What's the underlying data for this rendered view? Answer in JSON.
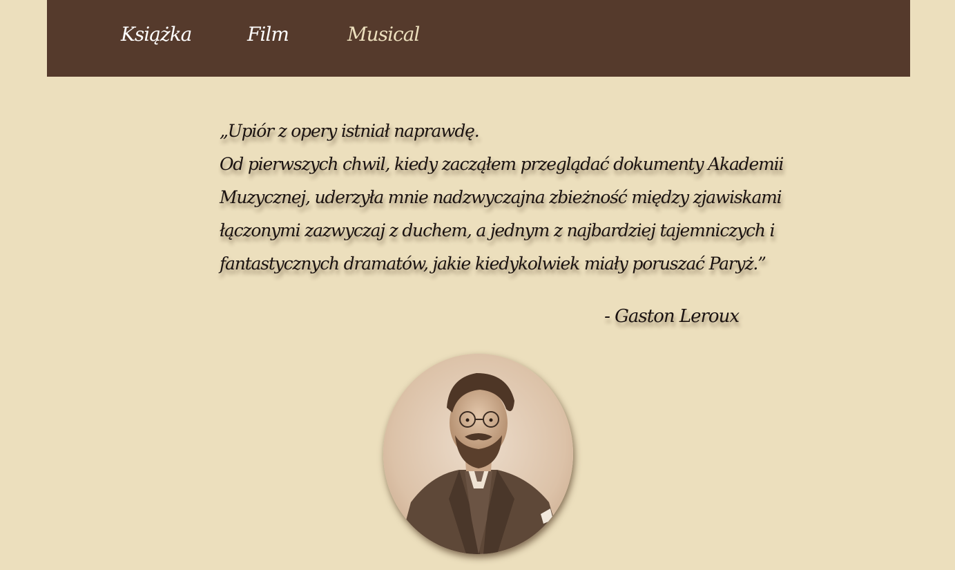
{
  "nav": {
    "items": [
      {
        "label": "Książka"
      },
      {
        "label": "Film"
      },
      {
        "label": "Musical"
      }
    ],
    "active_color": "#ecdfbd"
  },
  "quote": {
    "lines": [
      "„Upiór z opery istniał naprawdę.",
      "Od pierwszych chwil, kiedy zacząłem przeglądać dokumenty Akademii",
      "Muzycznej, uderzyła mnie nadzwyczajna zbieżność między zjawiskami",
      "łączonymi zazwyczaj z duchem, a jednym z najbardziej tajemniczych i",
      "fantastycznych dramatów, jakie kiedykolwiek miały poruszać Paryż.”"
    ],
    "author": "- Gaston Leroux"
  },
  "colors": {
    "background": "#ecdfbd",
    "navbar": "#553a2c",
    "text": "#1a1210"
  }
}
